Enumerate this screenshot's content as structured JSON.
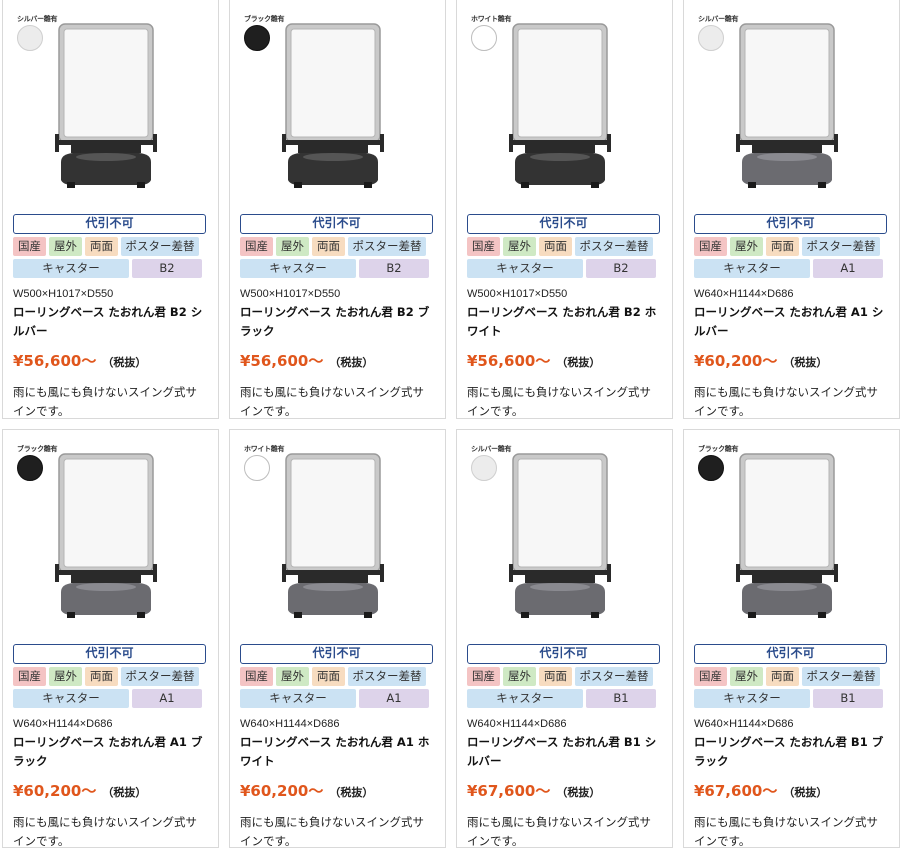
{
  "colors": {
    "accent_price": "#e0561c",
    "cod_border": "#2b4c8c"
  },
  "products": [
    {
      "color_label": "シルバー雛有",
      "color": "silver",
      "base": "black",
      "cod": "代引不可",
      "tags": [
        "国産",
        "屋外",
        "両面",
        "ポスター差替"
      ],
      "caster": "キャスター",
      "size": "B2",
      "dims": "W500×H1017×D550",
      "name": "ローリングベース たおれん君 B2 シルバー",
      "price": "¥56,600〜",
      "tax": "（税抜）",
      "desc": "雨にも風にも負けないスイング式サインです。"
    },
    {
      "color_label": "ブラック雛有",
      "color": "black",
      "base": "black",
      "cod": "代引不可",
      "tags": [
        "国産",
        "屋外",
        "両面",
        "ポスター差替"
      ],
      "caster": "キャスター",
      "size": "B2",
      "dims": "W500×H1017×D550",
      "name": "ローリングベース たおれん君 B2 ブラック",
      "price": "¥56,600〜",
      "tax": "（税抜）",
      "desc": "雨にも風にも負けないスイング式サインです。"
    },
    {
      "color_label": "ホワイト雛有",
      "color": "white",
      "base": "black",
      "cod": "代引不可",
      "tags": [
        "国産",
        "屋外",
        "両面",
        "ポスター差替"
      ],
      "caster": "キャスター",
      "size": "B2",
      "dims": "W500×H1017×D550",
      "name": "ローリングベース たおれん君 B2 ホワイト",
      "price": "¥56,600〜",
      "tax": "（税抜）",
      "desc": "雨にも風にも負けないスイング式サインです。"
    },
    {
      "color_label": "シルバー雛有",
      "color": "silver",
      "base": "grey",
      "cod": "代引不可",
      "tags": [
        "国産",
        "屋外",
        "両面",
        "ポスター差替"
      ],
      "caster": "キャスター",
      "size": "A1",
      "dims": "W640×H1144×D686",
      "name": "ローリングベース たおれん君 A1 シルバー",
      "price": "¥60,200〜",
      "tax": "（税抜）",
      "desc": "雨にも風にも負けないスイング式サインです。"
    },
    {
      "color_label": "ブラック雛有",
      "color": "black",
      "base": "grey",
      "cod": "代引不可",
      "tags": [
        "国産",
        "屋外",
        "両面",
        "ポスター差替"
      ],
      "caster": "キャスター",
      "size": "A1",
      "dims": "W640×H1144×D686",
      "name": "ローリングベース たおれん君 A1 ブラック",
      "price": "¥60,200〜",
      "tax": "（税抜）",
      "desc": "雨にも風にも負けないスイング式サインです。"
    },
    {
      "color_label": "ホワイト雛有",
      "color": "white",
      "base": "grey",
      "cod": "代引不可",
      "tags": [
        "国産",
        "屋外",
        "両面",
        "ポスター差替"
      ],
      "caster": "キャスター",
      "size": "A1",
      "dims": "W640×H1144×D686",
      "name": "ローリングベース たおれん君 A1 ホワイト",
      "price": "¥60,200〜",
      "tax": "（税抜）",
      "desc": "雨にも風にも負けないスイング式サインです。"
    },
    {
      "color_label": "シルバー雛有",
      "color": "silver",
      "base": "grey",
      "cod": "代引不可",
      "tags": [
        "国産",
        "屋外",
        "両面",
        "ポスター差替"
      ],
      "caster": "キャスター",
      "size": "B1",
      "dims": "W640×H1144×D686",
      "name": "ローリングベース たおれん君 B1 シルバー",
      "price": "¥67,600〜",
      "tax": "（税抜）",
      "desc": "雨にも風にも負けないスイング式サインです。"
    },
    {
      "color_label": "ブラック雛有",
      "color": "black",
      "base": "grey",
      "cod": "代引不可",
      "tags": [
        "国産",
        "屋外",
        "両面",
        "ポスター差替"
      ],
      "caster": "キャスター",
      "size": "B1",
      "dims": "W640×H1144×D686",
      "name": "ローリングベース たおれん君 B1 ブラック",
      "price": "¥67,600〜",
      "tax": "（税抜）",
      "desc": "雨にも風にも負けないスイング式サインです。"
    }
  ]
}
